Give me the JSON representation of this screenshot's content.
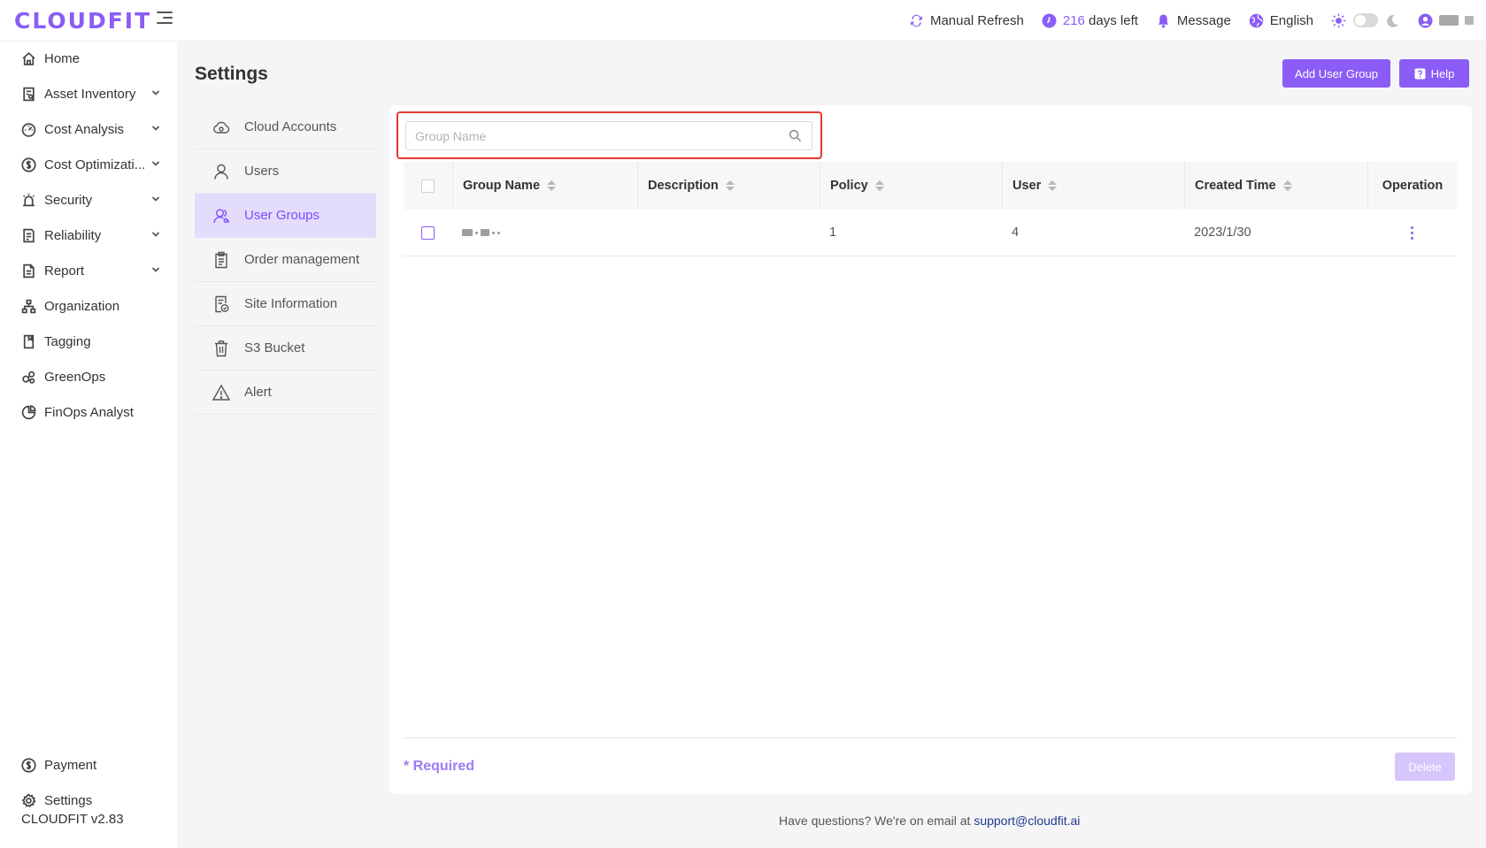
{
  "app": {
    "logo": "CLOUDFIT",
    "version": "CLOUDFIT v2.83"
  },
  "header": {
    "refresh_label": "Manual Refresh",
    "days_count": "216",
    "days_suffix": "days left",
    "message_label": "Message",
    "language_label": "English"
  },
  "sidebar": {
    "items": [
      {
        "label": "Home",
        "icon": "home-icon",
        "expandable": false
      },
      {
        "label": "Asset Inventory",
        "icon": "inventory-icon",
        "expandable": true
      },
      {
        "label": "Cost Analysis",
        "icon": "gauge-icon",
        "expandable": true
      },
      {
        "label": "Cost Optimizati...",
        "icon": "dollar-icon",
        "expandable": true
      },
      {
        "label": "Security",
        "icon": "alarm-icon",
        "expandable": true
      },
      {
        "label": "Reliability",
        "icon": "reliability-icon",
        "expandable": true
      },
      {
        "label": "Report",
        "icon": "report-icon",
        "expandable": true
      },
      {
        "label": "Organization",
        "icon": "org-icon",
        "expandable": false
      },
      {
        "label": "Tagging",
        "icon": "tag-icon",
        "expandable": false
      },
      {
        "label": "GreenOps",
        "icon": "leaf-icon",
        "expandable": false
      },
      {
        "label": "FinOps Analyst",
        "icon": "analyst-icon",
        "expandable": false
      }
    ],
    "bottom": [
      {
        "label": "Payment",
        "icon": "dollar-icon"
      },
      {
        "label": "Settings",
        "icon": "gear-icon"
      }
    ]
  },
  "page": {
    "title": "Settings",
    "add_button": "Add User Group",
    "help_button": "Help"
  },
  "settings_menu": [
    {
      "label": "Cloud Accounts",
      "icon": "cloud-icon",
      "active": false
    },
    {
      "label": "Users",
      "icon": "user-icon",
      "active": false
    },
    {
      "label": "User Groups",
      "icon": "user-group-icon",
      "active": true
    },
    {
      "label": "Order management",
      "icon": "clipboard-icon",
      "active": false
    },
    {
      "label": "Site Information",
      "icon": "site-info-icon",
      "active": false
    },
    {
      "label": "S3 Bucket",
      "icon": "bucket-icon",
      "active": false
    },
    {
      "label": "Alert",
      "icon": "warning-icon",
      "active": false
    }
  ],
  "search": {
    "placeholder": "Group Name",
    "value": ""
  },
  "table": {
    "columns": [
      "Group Name",
      "Description",
      "Policy",
      "User",
      "Created Time",
      "Operation"
    ],
    "rows": [
      {
        "group_name": "",
        "description": "",
        "policy": "1",
        "user": "4",
        "created_time": "2023/1/30"
      }
    ]
  },
  "footer": {
    "required_label": "* Required",
    "delete_button": "Delete",
    "help_text": "Have questions? We're on email at",
    "email": "support@cloudfit.ai"
  },
  "colors": {
    "accent": "#8b5cf6",
    "active_bg": "#e4dcfb",
    "highlight_border": "#e53935"
  }
}
